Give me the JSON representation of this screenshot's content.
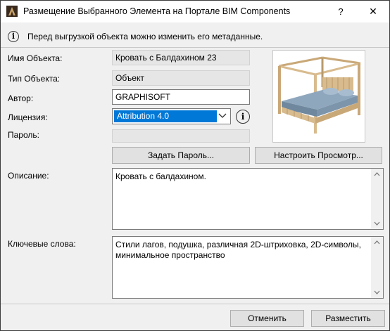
{
  "window": {
    "title": "Размещение Выбранного Элемента на Портале BIM Components",
    "help_label": "?",
    "close_label": "✕"
  },
  "info": {
    "text": "Перед выгрузкой объекта можно изменить его метаданные."
  },
  "form": {
    "object_name_label": "Имя Объекта:",
    "object_name_value": "Кровать с Балдахином 23",
    "object_type_label": "Тип Объекта:",
    "object_type_value": "Объект",
    "author_label": "Автор:",
    "author_value": "GRAPHISOFT",
    "license_label": "Лицензия:",
    "license_value": "Attribution 4.0",
    "password_label": "Пароль:",
    "password_value": "",
    "set_password_button": "Задать Пароль...",
    "configure_preview_button": "Настроить Просмотр...",
    "description_label": "Описание:",
    "description_value": "Кровать с балдахином.",
    "keywords_label": "Ключевые слова:",
    "keywords_value": "Стили лагов, подушка, различная 2D-штриховка, 2D-символы, минимальное пространство"
  },
  "footer": {
    "cancel_button": "Отменить",
    "publish_button": "Разместить"
  },
  "colors": {
    "selection": "#0078d7",
    "dialog_bg": "#f0f0f0",
    "readonly_field": "#e6e6e6"
  },
  "icons": [
    "archicad-app-icon",
    "info-icon",
    "chevron-down-icon",
    "bed-preview-image",
    "scroll-up-icon",
    "scroll-down-icon"
  ]
}
